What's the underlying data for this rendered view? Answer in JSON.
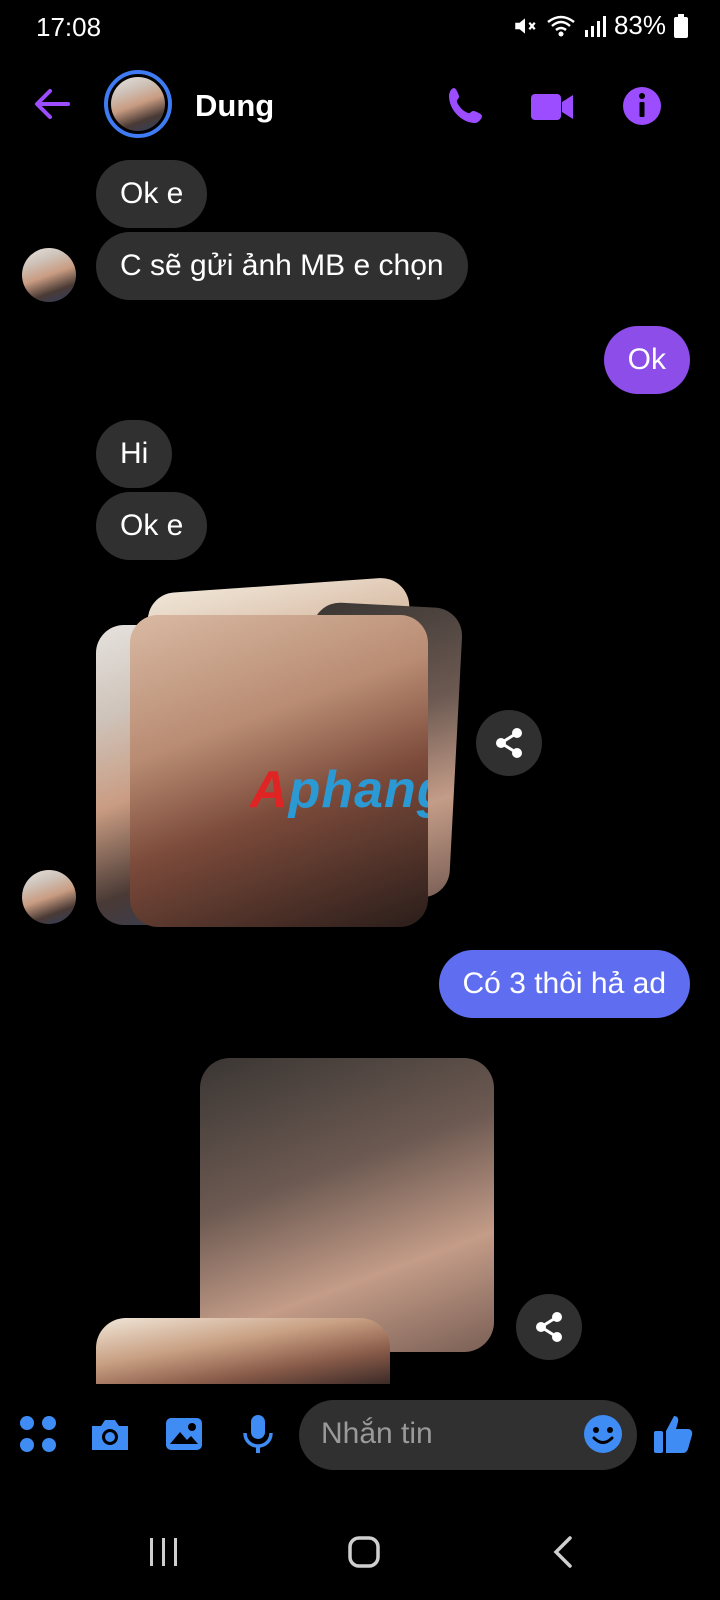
{
  "status_bar": {
    "time": "17:08",
    "battery": "83%"
  },
  "header": {
    "contact_name": "Dung"
  },
  "messages": {
    "m1": "Ok e",
    "m2": "C sẽ gửi ảnh MB e chọn",
    "m3": "Ok",
    "m4": "Hi",
    "m5": "Ok e",
    "m6": "Có 3 thôi hả ad"
  },
  "watermark": {
    "part1": "A",
    "part2": "phang"
  },
  "composer": {
    "placeholder": "Nhắn tin"
  },
  "colors": {
    "accent": "#9b4dff",
    "outgoing_purple": "#8c4de8",
    "outgoing_blue": "#5f6ef0",
    "incoming": "#303030",
    "composer_blue": "#3f8cf5"
  }
}
